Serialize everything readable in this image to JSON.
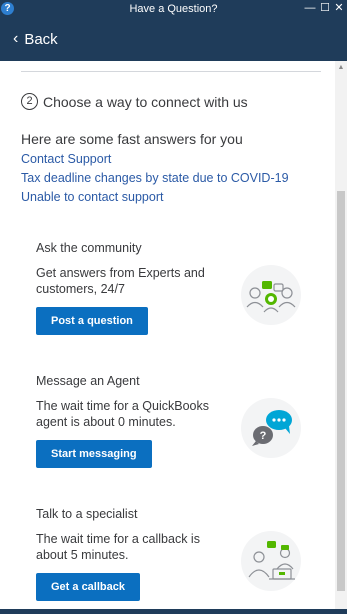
{
  "window": {
    "title": "Have a Question?",
    "app_icon_glyph": "?",
    "min_glyph": "—",
    "max_glyph": "☐",
    "close_glyph": "✕"
  },
  "nav": {
    "back_label": "Back",
    "back_chevron": "‹"
  },
  "step": {
    "number": "2",
    "text": "Choose a way to connect with us"
  },
  "fast_answers": {
    "title": "Here are some fast answers for you",
    "links": [
      "Contact Support",
      "Tax deadline changes by state due to COVID-19",
      "Unable to contact support"
    ]
  },
  "options": [
    {
      "title": "Ask the community",
      "description": "Get answers from Experts and customers, 24/7",
      "button": "Post a question",
      "icon": "community-icon"
    },
    {
      "title": "Message an Agent",
      "description": "The wait time for a QuickBooks agent is about 0 minutes.",
      "button": "Start messaging",
      "icon": "chat-icon"
    },
    {
      "title": "Talk to a specialist",
      "description": "The wait time for a callback is about 5 minutes.",
      "button": "Get a callback",
      "icon": "callback-icon"
    }
  ],
  "colors": {
    "header": "#1f3c5a",
    "link": "#2b5aa6",
    "button": "#0b6fc0",
    "text": "#393a3d"
  }
}
